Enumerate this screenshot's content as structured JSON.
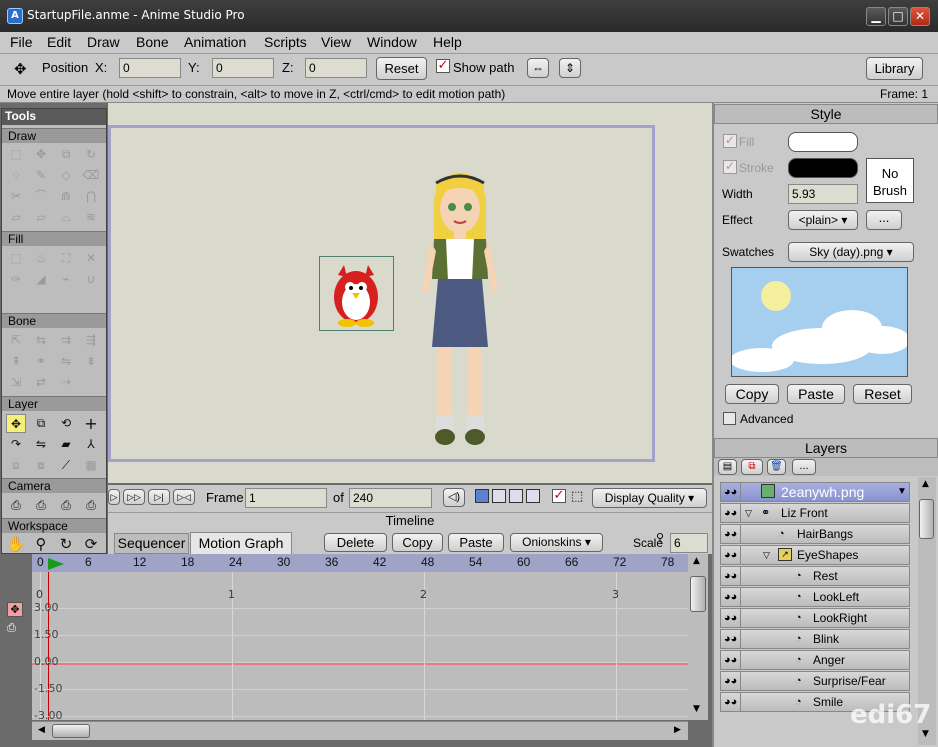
{
  "window": {
    "title": "StartupFile.anme - Anime Studio Pro",
    "app_icon": "A",
    "minimize": "▁",
    "maximize": "□",
    "close": "✕"
  },
  "menu": [
    "File",
    "Edit",
    "Draw",
    "Bone",
    "Animation",
    "Scripts",
    "View",
    "Window",
    "Help"
  ],
  "toolbar": {
    "position_label": "Position",
    "x_label": "X:",
    "x_value": "0",
    "y_label": "Y:",
    "y_value": "0",
    "z_label": "Z:",
    "z_value": "0",
    "reset": "Reset",
    "show_path": "Show path",
    "library": "Library"
  },
  "status": {
    "hint": "Move entire layer (hold <shift> to constrain, <alt> to move in Z, <ctrl/cmd> to edit motion path)",
    "frame": "Frame: 1"
  },
  "tools": {
    "title": "Tools",
    "sections": {
      "draw": "Draw",
      "fill": "Fill",
      "bone": "Bone",
      "layer": "Layer",
      "camera": "Camera",
      "workspace": "Workspace"
    }
  },
  "timeline_controls": {
    "frame_label": "Frame",
    "frame_value": "1",
    "of_label": "of",
    "total_frames": "240",
    "display_quality": "Display Quality"
  },
  "timeline": {
    "title": "Timeline",
    "tabs": [
      "Sequencer",
      "Motion Graph"
    ],
    "active_tab": "Motion Graph",
    "buttons": {
      "delete": "Delete",
      "copy": "Copy",
      "paste": "Paste",
      "onionskins": "Onionskins"
    },
    "scale_label": "Scale",
    "scale_value": "6",
    "ruler_ticks": [
      "0",
      "6",
      "12",
      "18",
      "24",
      "30",
      "36",
      "42",
      "48",
      "54",
      "60",
      "66",
      "72",
      "78"
    ],
    "graph_x_ticks": [
      "0",
      "1",
      "2",
      "3"
    ],
    "graph_y_ticks": [
      "3.00",
      "1.50",
      "0.00",
      "-1.50",
      "-3.00"
    ]
  },
  "style_panel": {
    "title": "Style",
    "fill_label": "Fill",
    "stroke_label": "Stroke",
    "no_brush": "No Brush",
    "width_label": "Width",
    "width_value": "5.93",
    "effect_label": "Effect",
    "effect_value": "<plain>",
    "effect_more": "...",
    "swatches_label": "Swatches",
    "swatches_value": "Sky (day).png",
    "copy": "Copy",
    "paste": "Paste",
    "reset": "Reset",
    "advanced": "Advanced",
    "fill_color": "#ffffff",
    "stroke_color": "#000000"
  },
  "layers_panel": {
    "title": "Layers",
    "more": "...",
    "items": [
      {
        "name": "2eanywh.png",
        "selected": true
      },
      {
        "name": "Liz Front"
      },
      {
        "name": "HairBangs"
      },
      {
        "name": "EyeShapes"
      },
      {
        "name": "Rest"
      },
      {
        "name": "LookLeft"
      },
      {
        "name": "LookRight"
      },
      {
        "name": "Blink"
      },
      {
        "name": "Anger"
      },
      {
        "name": "Surprise/Fear"
      },
      {
        "name": "Smile"
      }
    ]
  },
  "watermark": "edi67"
}
